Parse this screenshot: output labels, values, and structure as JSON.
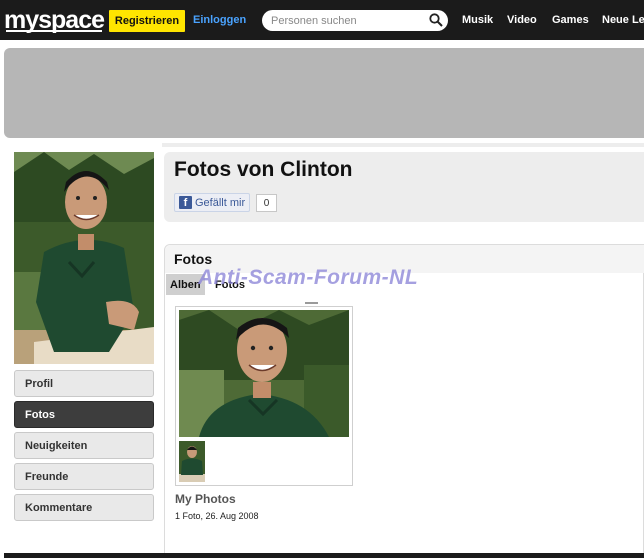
{
  "header": {
    "logo": "myspace",
    "register_label": "Registrieren",
    "login_label": "Einloggen",
    "search_placeholder": "Personen suchen",
    "nav": [
      "Musik",
      "Video",
      "Games",
      "Neue Le"
    ]
  },
  "sidebar": {
    "items": [
      {
        "label": "Profil"
      },
      {
        "label": "Fotos"
      },
      {
        "label": "Neuigkeiten"
      },
      {
        "label": "Freunde"
      },
      {
        "label": "Kommentare"
      }
    ],
    "active_item": "Fotos"
  },
  "main": {
    "page_title": "Fotos von Clinton",
    "like_label": "Gefällt mir",
    "like_count": "0"
  },
  "photos": {
    "heading": "Fotos",
    "tabs": [
      "Alben",
      "Fotos"
    ],
    "watermark": "Anti-Scam-Forum-NL",
    "album": {
      "name": "My Photos",
      "meta": "1 Foto, 26. Aug 2008"
    }
  },
  "colors": {
    "topbar": "#1b1b1b",
    "register": "#ffe500",
    "login_link": "#4aa3ff",
    "active_sidebar": "#3d3d3d",
    "facebook": "#3b5998",
    "watermark": "#8d86d8"
  }
}
